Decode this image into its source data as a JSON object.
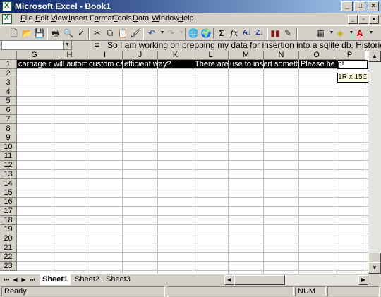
{
  "window": {
    "title": "Microsoft Excel - Book1"
  },
  "menu": [
    "File",
    "Edit",
    "View",
    "Insert",
    "Format",
    "Tools",
    "Data",
    "Window",
    "Help"
  ],
  "menu_access": [
    "F",
    "E",
    "V",
    "I",
    "o",
    "T",
    "D",
    "W",
    "H"
  ],
  "toolbar_icons": [
    "new-icon",
    "open-icon",
    "save-icon",
    "print-icon",
    "print-preview-icon",
    "spelling-icon",
    "cut-icon",
    "copy-icon",
    "paste-icon",
    "format-painter-icon",
    "undo-icon",
    "redo-icon",
    "hyperlink-icon",
    "web-toolbar-icon",
    "autosum-icon",
    "function-icon",
    "sort-ascending-icon",
    "sort-descending-icon",
    "chart-wizard-icon",
    "drawing-icon",
    "borders-icon",
    "fill-color-icon",
    "font-color-icon"
  ],
  "formula_bar": {
    "name_box": "",
    "equals": "=",
    "text": "So I am working on prepping my data for insertion into a sqlite db. Historically, I"
  },
  "columns": [
    "G",
    "H",
    "I",
    "J",
    "K",
    "L",
    "M",
    "N",
    "O",
    "P"
  ],
  "rows": [
    "1",
    "2",
    "3",
    "4",
    "5",
    "6",
    "7",
    "8",
    "9",
    "10",
    "11",
    "12",
    "13",
    "14",
    "15",
    "16",
    "17",
    "18",
    "19",
    "20",
    "21",
    "22",
    "23"
  ],
  "row1_cells": [
    "carriage re",
    "will automa",
    "custom cs",
    "efficient way?",
    "",
    "There are r",
    "use to insert somethin",
    "",
    "Please he",
    "lp!"
  ],
  "selection_tooltip": "1R x 15C",
  "sheet_tabs": [
    "Sheet1",
    "Sheet2",
    "Sheet3"
  ],
  "active_tab": "Sheet1",
  "status": {
    "left": "Ready",
    "num": "NUM"
  },
  "colors": {
    "title_start": "#0a246a",
    "title_end": "#a6caf0",
    "chrome": "#d4d0c8",
    "selection": "#000000"
  }
}
